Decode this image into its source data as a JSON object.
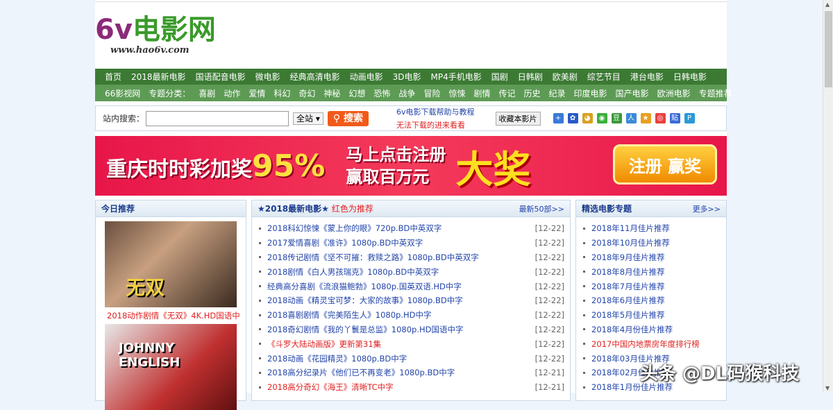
{
  "logo": {
    "text": "6v电影网",
    "url": "www.hao6v.com"
  },
  "nav_main": [
    "首页",
    "2018最新电影",
    "国语配音电影",
    "微电影",
    "经典高清电影",
    "动画电影",
    "3D电影",
    "MP4手机电影",
    "国剧",
    "日韩剧",
    "欧美剧",
    "综艺节目",
    "港台电影",
    "日韩电影"
  ],
  "nav_sub": {
    "site": "66影视网",
    "label": "专题分类：",
    "items": [
      "喜剧",
      "动作",
      "爱情",
      "科幻",
      "奇幻",
      "神秘",
      "幻想",
      "恐怖",
      "战争",
      "冒险",
      "惊悚",
      "剧情",
      "传记",
      "历史",
      "纪录",
      "印度电影",
      "国产电影",
      "欧洲电影",
      "专题推荐"
    ]
  },
  "search": {
    "label": "站内搜索：",
    "value": "",
    "scope": "全站",
    "button": "搜索",
    "help_link": "6v电影下载帮助与教程",
    "help_red": "无法下载的进来看看",
    "favorite": "收藏本影片"
  },
  "share_icons": [
    "plus-icon",
    "baidu-icon",
    "qq-icon",
    "wechat-icon",
    "douban-icon",
    "renren-icon",
    "qzone-icon",
    "weibo-icon",
    "tieba-icon",
    "pengyou-icon"
  ],
  "banner": {
    "t1": "重庆时时彩加奖",
    "pct": "95%",
    "t2": "马上点击注册",
    "t3": "赢取百万元",
    "t4": "大奖",
    "btn": "注册 赢奖"
  },
  "today": {
    "title": "今日推荐",
    "poster1": "无双",
    "caption1": "2018动作剧情《无双》4K.HD国语中",
    "poster2": "JOHNNY ENGLISH"
  },
  "latest": {
    "title": "★2018最新电影★",
    "note": "红色为推荐",
    "more": "最新50部>>",
    "items": [
      {
        "t": "2018科幻惊悚《蒙上你的眼》720p.BD中英双字",
        "d": "[12-22]"
      },
      {
        "t": "2017爱情喜剧《准许》1080p.BD中英双字",
        "d": "[12-22]"
      },
      {
        "t": "2018传记剧情《坚不可摧：救赎之路》1080p.BD中英双字",
        "d": "[12-22]"
      },
      {
        "t": "2018剧情《白人男孩瑞克》1080p.BD中英双字",
        "d": "[12-22]"
      },
      {
        "t": "经典高分喜剧《流浪猫鲍勃》1080p.国英双语.HD中字",
        "d": "[12-22]"
      },
      {
        "t": "2018动画《精灵宝可梦：大家的故事》1080p.BD中字",
        "d": "[12-22]"
      },
      {
        "t": "2018喜剧剧情《完美陌生人》1080p.HD中字",
        "d": "[12-22]"
      },
      {
        "t": "2018奇幻剧情《我的丫鬟是总监》1080p.HD国语中字",
        "d": "[12-22]"
      },
      {
        "t": "《斗罗大陆动画版》更新第31集",
        "d": "[12-22]",
        "hot": true
      },
      {
        "t": "2018动画《花园精灵》1080p.BD中字",
        "d": "[12-22]"
      },
      {
        "t": "2018高分纪录片《他们已不再变老》1080p.BD中字",
        "d": "[12-21]"
      },
      {
        "t": "2018高分奇幻《海王》清晰TC中字",
        "d": "[12-21]",
        "hot": true
      }
    ]
  },
  "topics": {
    "title": "精选电影专题",
    "more": "更多>>",
    "items": [
      {
        "t": "2018年11月佳片推荐"
      },
      {
        "t": "2018年10月佳片推荐"
      },
      {
        "t": "2018年9月佳片推荐"
      },
      {
        "t": "2018年8月佳片推荐"
      },
      {
        "t": "2018年7月佳片推荐"
      },
      {
        "t": "2018年6月佳片推荐"
      },
      {
        "t": "2018年5月佳片推荐"
      },
      {
        "t": "2018年4月份佳片推荐"
      },
      {
        "t": "2017中国内地票房年度排行榜",
        "hot": true
      },
      {
        "t": "2018年03月佳片推荐"
      },
      {
        "t": "2018年02月佳片推荐"
      },
      {
        "t": "2018年1月份佳片推荐"
      }
    ]
  },
  "watermark": "头条 @DL码猴科技"
}
